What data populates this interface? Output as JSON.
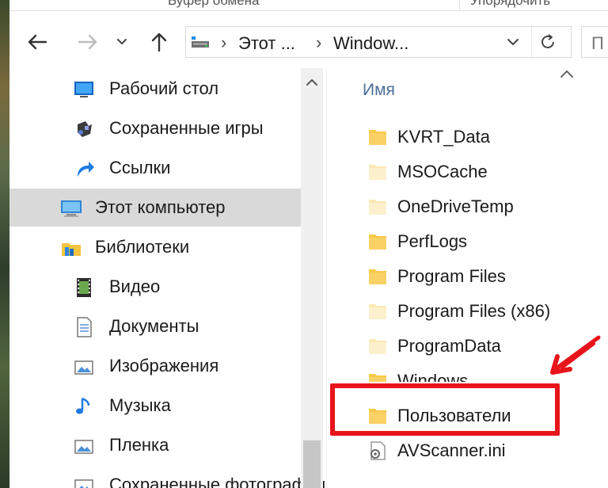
{
  "ribbon": {
    "left_text": "Буфер обмена",
    "right_text": "Упорядочить"
  },
  "nav": {
    "back_icon": "arrow-left-icon",
    "forward_icon": "arrow-right-icon",
    "recent_icon": "chevron-down-icon",
    "up_icon": "arrow-up-icon"
  },
  "address": {
    "drive_icon": "drive-icon",
    "segment1": "Этот ...",
    "segment2": "Window...",
    "separator": "›",
    "dropdown_icon": "chevron-down-icon",
    "refresh_icon": "refresh-icon"
  },
  "search": {
    "placeholder": "П"
  },
  "navpane": {
    "items": [
      {
        "label": "Рабочий стол",
        "icon": "desktop-icon",
        "indent": 2
      },
      {
        "label": "Сохраненные игры",
        "icon": "saved-games-icon",
        "indent": 2
      },
      {
        "label": "Ссылки",
        "icon": "links-icon",
        "indent": 2
      },
      {
        "label": "Этот компьютер",
        "icon": "computer-icon",
        "indent": 1,
        "selected": true
      },
      {
        "label": "Библиотеки",
        "icon": "libraries-icon",
        "indent": 1
      },
      {
        "label": "Видео",
        "icon": "video-icon",
        "indent": 2
      },
      {
        "label": "Документы",
        "icon": "documents-icon",
        "indent": 2
      },
      {
        "label": "Изображения",
        "icon": "pictures-icon",
        "indent": 2
      },
      {
        "label": "Музыка",
        "icon": "music-icon",
        "indent": 2
      },
      {
        "label": "Пленка",
        "icon": "camera-roll-icon",
        "indent": 2
      },
      {
        "label": "Сохраненные фотографии",
        "icon": "saved-pictures-icon",
        "indent": 2
      }
    ]
  },
  "content": {
    "column_header": "Имя",
    "files": [
      {
        "name": "KVRT_Data",
        "type": "folder"
      },
      {
        "name": "MSOCache",
        "type": "folder-hidden"
      },
      {
        "name": "OneDriveTemp",
        "type": "folder-hidden"
      },
      {
        "name": "PerfLogs",
        "type": "folder"
      },
      {
        "name": "Program Files",
        "type": "folder"
      },
      {
        "name": "Program Files (x86)",
        "type": "folder-hidden"
      },
      {
        "name": "ProgramData",
        "type": "folder-hidden"
      },
      {
        "name": "Windows",
        "type": "folder"
      },
      {
        "name": "Пользователи",
        "type": "folder"
      },
      {
        "name": "AVScanner.ini",
        "type": "settings-file"
      }
    ]
  },
  "annotation": {
    "highlight_color": "#e8141b",
    "highlighted_item": "Пользователи"
  }
}
